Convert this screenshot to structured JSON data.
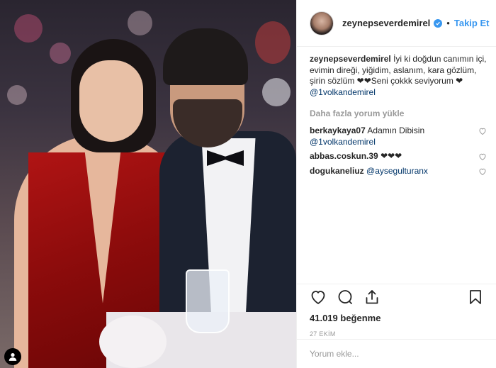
{
  "post": {
    "username": "zeynepseverdemirel",
    "follow_label": "Takip Et",
    "dot": "•",
    "caption_text": "İyi ki doğdun canımın içi, evimin direği, yiğidim, aslanım, kara gözlüm, şirin sözlüm ❤❤Seni çokkk seviyorum ❤",
    "caption_mention": "@1volkandemirel",
    "load_more": "Daha fazla yorum yükle",
    "comments": [
      {
        "user": "berkaykaya07",
        "text": "Adamın Dibisin",
        "mention": "@1volkandemirel"
      },
      {
        "user": "abbas.coskun.39",
        "text": "❤❤❤",
        "mention": ""
      },
      {
        "user": "dogukaneliuz",
        "text": "",
        "mention": "@aysegulturanx"
      }
    ],
    "likes": "41.019 beğenme",
    "date": "27 EKİM",
    "comment_placeholder": "Yorum ekle..."
  },
  "icons": {
    "like": "heart-icon",
    "comment": "comment-icon",
    "share": "share-icon",
    "save": "bookmark-icon",
    "verified": "verified-badge-icon",
    "photo_badge": "user-tag-icon"
  },
  "colors": {
    "link": "#3897f0",
    "mention": "#003569",
    "muted": "#999999"
  }
}
